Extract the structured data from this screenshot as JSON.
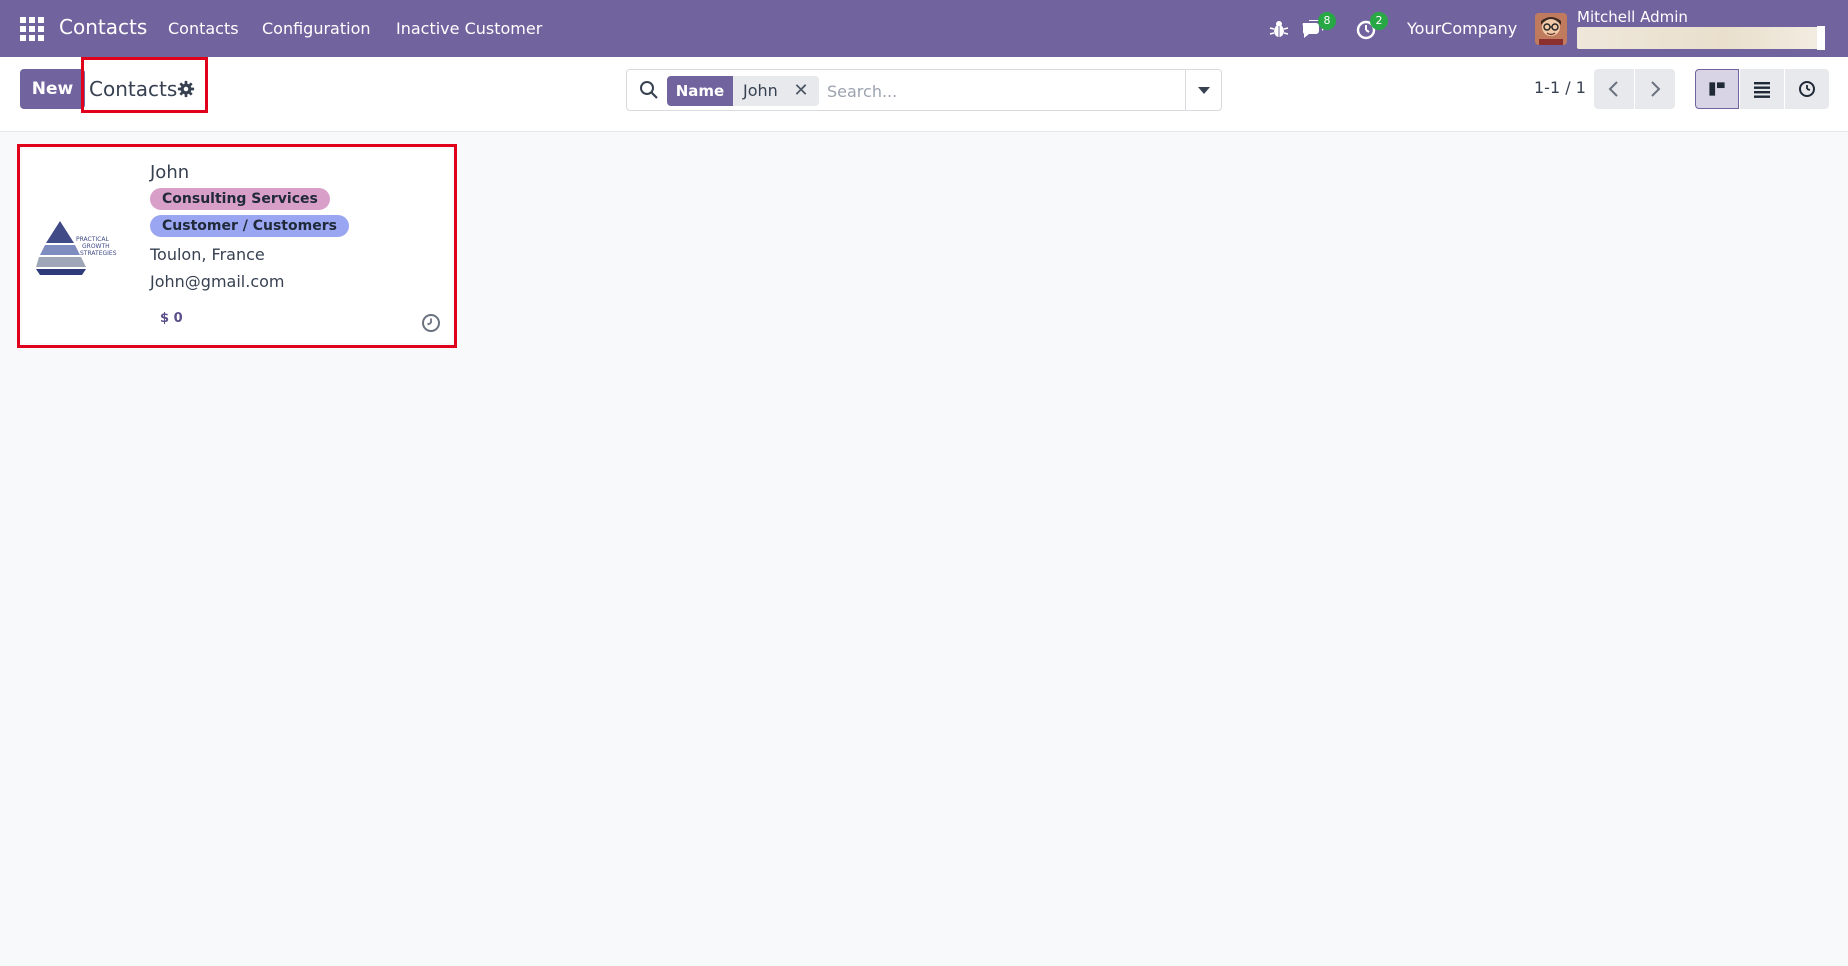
{
  "navbar": {
    "app_name": "Contacts",
    "menus": [
      "Contacts",
      "Configuration",
      "Inactive Customer"
    ],
    "messages_count": "8",
    "activities_count": "2",
    "company": "YourCompany",
    "user_name": "Mitchell Admin"
  },
  "control_panel": {
    "new_label": "New",
    "title": "Contacts",
    "search": {
      "facet_label": "Name",
      "facet_value": "John",
      "facet_remove": "✕",
      "placeholder": "Search..."
    },
    "pager": "1-1 / 1"
  },
  "card": {
    "name": "John",
    "tags": [
      "Consulting Services",
      "Customer / Customers"
    ],
    "address": "Toulon, France",
    "email": "John@gmail.com",
    "sales": "$ 0",
    "logo_text": [
      "PRACTICAL",
      "GROWTH",
      "STRATEGIES"
    ]
  },
  "colors": {
    "brand": "#71639e",
    "highlight": "#e0001b",
    "badge": "#28a745"
  }
}
